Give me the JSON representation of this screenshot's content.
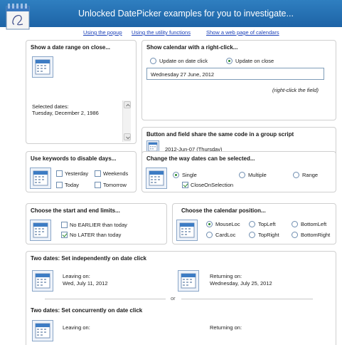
{
  "header": {
    "title": "Unlocked DatePicker examples for you to investigate...",
    "logo_icon": "calendar-logo-icon"
  },
  "links": [
    {
      "label": "Using the popup"
    },
    {
      "label": "Using the utility functions"
    },
    {
      "label": "Show a web page of calendars"
    }
  ],
  "date_range": {
    "title": "Show a date range on close...",
    "selected_label": "Selected dates:",
    "selected_value": "Tuesday, December 2, 1986"
  },
  "right_click": {
    "title": "Show calendar with a right-click...",
    "option_date_click": "Update on date click",
    "option_close": "Update on close",
    "selected_option": "Update on close",
    "field_value": "Wednesday 27 June, 2012",
    "hint": "(right-click the field)"
  },
  "group_script": {
    "title": "Button and field share the same code in a group script",
    "date_value": "2012-Jun-07 (Thursday)"
  },
  "keywords": {
    "title": "Use keywords to disable days...",
    "yesterday": "Yesterday",
    "weekends": "Weekends",
    "today": "Today",
    "tomorrow": "Tomorrow"
  },
  "selection_mode": {
    "title": "Change the way dates can be selected...",
    "single": "Single",
    "multiple": "Multiple",
    "range": "Range",
    "selected": "Single",
    "close_on_selection": "CloseOnSelection",
    "close_on_selection_checked": true
  },
  "limits": {
    "title": "Choose the start and end limits...",
    "no_earlier": "No EARLIER than today",
    "no_later": "No LATER than today",
    "no_later_checked": true
  },
  "position": {
    "title": "Choose the calendar position...",
    "options": [
      "MouseLoc",
      "TopLeft",
      "BottomLeft",
      "CardLoc",
      "TopRight",
      "BottomRight"
    ],
    "selected": "MouseLoc"
  },
  "two_dates_independent": {
    "title": "Two dates: Set independently on date click",
    "leaving_label": "Leaving on:",
    "leaving_value": "Wed, July 11, 2012",
    "returning_label": "Returning on:",
    "returning_value": "Wednesday, July 25, 2012"
  },
  "or_separator": "or",
  "two_dates_concurrent": {
    "title": "Two dates: Set concurrently on date click",
    "leaving_label": "Leaving on:",
    "returning_label": "Returning on:"
  },
  "colors": {
    "header_top": "#2f7fc0",
    "header_bottom": "#1d63a6",
    "link": "#1a3fb8",
    "radio_dot": "#2a8a2a"
  }
}
